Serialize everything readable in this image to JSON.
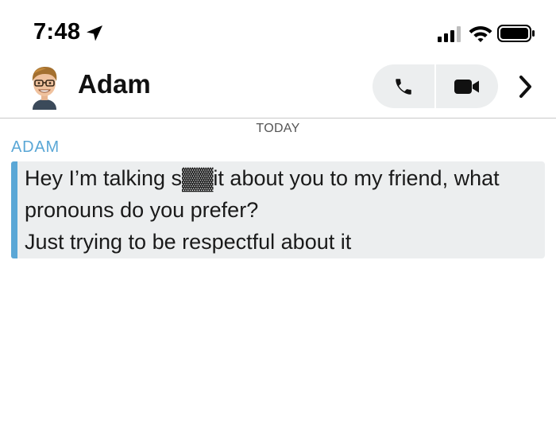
{
  "status_bar": {
    "time": "7:48",
    "icons": [
      "location-arrow-icon",
      "cellular-signal-icon",
      "wifi-icon",
      "battery-icon"
    ]
  },
  "header": {
    "contact_name": "Adam",
    "actions": [
      "phone-icon",
      "video-camera-icon",
      "chevron-right-icon"
    ]
  },
  "conversation": {
    "date_separator": "TODAY",
    "sender": "ADAM",
    "message_lines": [
      "Hey I’m talking s▓▓it about you to my friend, what",
      "pronouns do you prefer?",
      "Just trying to be respectful about it"
    ]
  },
  "colors": {
    "accent_blue": "#5aa7d6",
    "bubble_grey": "#eceeef",
    "text_dark": "#1a1a1a"
  }
}
